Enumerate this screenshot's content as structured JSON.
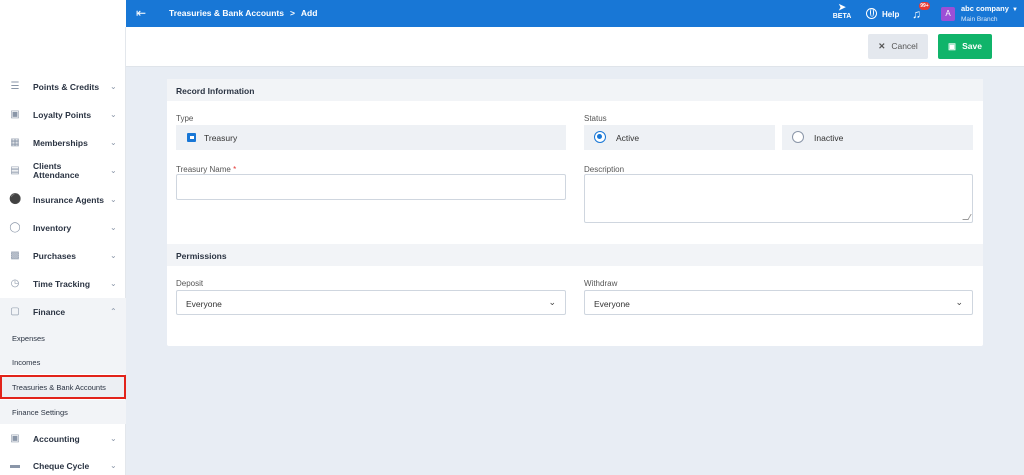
{
  "header": {
    "breadcrumb": [
      "Treasuries & Bank Accounts",
      "Add"
    ],
    "breadcrumb_sep": ">",
    "beta_label": "BETA",
    "help_label": "Help",
    "notification_count": "99+",
    "avatar_letter": "A",
    "company_name": "abc company",
    "branch_name": "Main Branch",
    "brand_color": "#1877d6"
  },
  "toolbar": {
    "cancel_label": "Cancel",
    "save_label": "Save",
    "save_color": "#10b46a"
  },
  "sidebar": {
    "items": [
      {
        "label": "Points & Credits",
        "icon": "layers-icon"
      },
      {
        "label": "Loyalty Points",
        "icon": "gift-icon"
      },
      {
        "label": "Memberships",
        "icon": "id-card-icon"
      },
      {
        "label": "Clients Attendance",
        "icon": "calendar-icon"
      },
      {
        "label": "Insurance Agents",
        "icon": "shield-icon"
      },
      {
        "label": "Inventory",
        "icon": "box-icon"
      },
      {
        "label": "Purchases",
        "icon": "truck-icon"
      },
      {
        "label": "Time Tracking",
        "icon": "clock-icon"
      },
      {
        "label": "Finance",
        "icon": "money-icon"
      },
      {
        "label": "Accounting",
        "icon": "cash-icon"
      },
      {
        "label": "Cheque Cycle",
        "icon": "cheque-icon"
      }
    ],
    "finance_subitems": [
      "Expenses",
      "Incomes",
      "Treasuries & Bank Accounts",
      "Finance Settings"
    ],
    "current_subitem": "Treasuries & Bank Accounts"
  },
  "form": {
    "record_section": "Record Information",
    "type_label": "Type",
    "type_value": "Treasury",
    "status_label": "Status",
    "status_options": [
      "Active",
      "Inactive"
    ],
    "status_selected": "Active",
    "name_label": "Treasury Name",
    "name_required_mark": "*",
    "name_value": "",
    "description_label": "Description",
    "description_value": "",
    "permissions_section": "Permissions",
    "deposit_label": "Deposit",
    "deposit_value": "Everyone",
    "withdraw_label": "Withdraw",
    "withdraw_value": "Everyone"
  }
}
